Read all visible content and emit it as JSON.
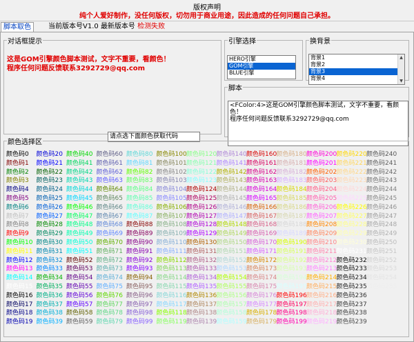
{
  "notice": {
    "title": "版权声明",
    "text": "纯个人爱好制作，没任何版权，切勿用于商业用途，因此造成的任何问题自己承担。"
  },
  "tabs": {
    "active_label": "脚本取色"
  },
  "version_info": {
    "current": "当前版本号V1.0",
    "latest_label": "最新版本号",
    "latest_status": "检测失败"
  },
  "preview": {
    "legend": "对话框提示",
    "line1": "这是GOM引擎颜色脚本测试，文字不重要，看颜色！",
    "line2": "程序任何问题反馈联系3292729@qq.com"
  },
  "code_field": {
    "value": "请点选下面颜色获取代码"
  },
  "engine": {
    "legend": "引擎选择",
    "options": [
      "HERO引擎",
      "GOM引擎",
      "BLUE引擎"
    ],
    "selected_index": 1
  },
  "background": {
    "legend": "换背景",
    "options": [
      "背景1",
      "背景2",
      "背景3",
      "背景4"
    ],
    "selected_index": 2
  },
  "script": {
    "legend": "脚本",
    "line1": "<FColor:4>这是GOM引擎颜色脚本测试，文字不重要，看颜色！",
    "line2": "程序任何问题反馈联系3292729@qq.com"
  },
  "color_section": {
    "legend": "颜色选择区",
    "item_prefix": "颜色码",
    "count": 256,
    "rows_per_column": 20,
    "palette": [
      "#000000",
      "#800000",
      "#008000",
      "#808000",
      "#000080",
      "#800080",
      "#008080",
      "#c0c0c0",
      "#808080",
      "#ff0000",
      "#00ff00",
      "#ffff00",
      "#0000ff",
      "#ff00ff",
      "#00ffff",
      "#ffffff",
      "#000000",
      "#00005f",
      "#000087",
      "#0000af",
      "#0000d7",
      "#0000ff",
      "#005f00",
      "#005f5f",
      "#005f87",
      "#005faf",
      "#005fd7",
      "#005fff",
      "#008700",
      "#00875f",
      "#008787",
      "#0087af",
      "#0087d7",
      "#0087ff",
      "#00af00",
      "#00af5f",
      "#00af87",
      "#00afaf",
      "#00afd7",
      "#00afff",
      "#00d700",
      "#00d75f",
      "#00d787",
      "#00d7af",
      "#00d7d7",
      "#00d7ff",
      "#00ff00",
      "#00ff5f",
      "#00ff87",
      "#00ffaf",
      "#00ffd7",
      "#00ffff",
      "#5f0000",
      "#5f005f",
      "#5f0087",
      "#5f00af",
      "#5f00d7",
      "#5f00ff",
      "#5f5f00",
      "#5f5f5f",
      "#5f5f87",
      "#5f5faf",
      "#5f5fd7",
      "#5f5fff",
      "#5f8700",
      "#5f875f",
      "#5f8787",
      "#5f87af",
      "#5f87d7",
      "#5f87ff",
      "#5faf00",
      "#5faf5f",
      "#5faf87",
      "#5fafaf",
      "#5fafd7",
      "#5fafff",
      "#5fd700",
      "#5fd75f",
      "#5fd787",
      "#5fd7af",
      "#5fd7d7",
      "#5fd7ff",
      "#5fff00",
      "#5fff5f",
      "#5fff87",
      "#5fffaf",
      "#5fffd7",
      "#5fffff",
      "#870000",
      "#87005f",
      "#870087",
      "#8700af",
      "#8700d7",
      "#8700ff",
      "#875f00",
      "#875f5f",
      "#875f87",
      "#875faf",
      "#875fd7",
      "#875fff",
      "#878700",
      "#87875f",
      "#878787",
      "#8787af",
      "#8787d7",
      "#8787ff",
      "#87af00",
      "#87af5f",
      "#87af87",
      "#87afaf",
      "#87afd7",
      "#87afff",
      "#87d700",
      "#87d75f",
      "#87d787",
      "#87d7af",
      "#87d7d7",
      "#87d7ff",
      "#87ff00",
      "#87ff5f",
      "#87ff87",
      "#87ffaf",
      "#87ffd7",
      "#87ffff",
      "#af0000",
      "#af005f",
      "#af0087",
      "#af00af",
      "#af00d7",
      "#af00ff",
      "#af5f00",
      "#af5f5f",
      "#af5f87",
      "#af5faf",
      "#af5fd7",
      "#af5fff",
      "#af8700",
      "#af875f",
      "#af8787",
      "#af87af",
      "#af87d7",
      "#af87ff",
      "#afaf00",
      "#afaf5f",
      "#afaf87",
      "#afafaf",
      "#afafd7",
      "#afafff",
      "#afd700",
      "#afd75f",
      "#afd787",
      "#afd7af",
      "#afd7d7",
      "#afd7ff",
      "#afff00",
      "#afff5f",
      "#afff87",
      "#afffaf",
      "#afffd7",
      "#afffff",
      "#d70000",
      "#d7005f",
      "#d70087",
      "#d700af",
      "#d700d7",
      "#d700ff",
      "#d75f00",
      "#d75f5f",
      "#d75f87",
      "#d75faf",
      "#d75fd7",
      "#d75fff",
      "#d78700",
      "#d7875f",
      "#d78787",
      "#d787af",
      "#d787d7",
      "#d787ff",
      "#d7af00",
      "#d7af5f",
      "#d7af87",
      "#d7afaf",
      "#d7afd7",
      "#d7afff",
      "#d7d700",
      "#d7d75f",
      "#d7d787",
      "#d7d7af",
      "#d7d7d7",
      "#d7d7ff",
      "#d7ff00",
      "#d7ff5f",
      "#d7ff87",
      "#d7ffaf",
      "#d7ffd7",
      "#d7ffff",
      "#ff0000",
      "#ff005f",
      "#ff0087",
      "#ff00af",
      "#ff00d7",
      "#ff00ff",
      "#ff5f00",
      "#ff5f5f",
      "#ff5f87",
      "#ff5faf",
      "#ff5fd7",
      "#ff5fff",
      "#ff8700",
      "#ff875f",
      "#ff8787",
      "#ff87af",
      "#ff87d7",
      "#ff87ff",
      "#ffaf00",
      "#ffaf5f",
      "#ffaf87",
      "#ffafaf",
      "#ffafd7",
      "#ffafff",
      "#ffd700",
      "#ffd75f",
      "#ffd787",
      "#ffd7af",
      "#ffd7d7",
      "#ffd7ff",
      "#ffff00",
      "#ffff5f",
      "#ffff87",
      "#ffffaf",
      "#ffffd7",
      "#ffffff",
      "#080808",
      "#121212",
      "#1c1c1c",
      "#262626",
      "#303030",
      "#3a3a3a",
      "#444444",
      "#4e4e4e",
      "#585858",
      "#626262",
      "#6c6c6c",
      "#767676",
      "#808080",
      "#8a8a8a",
      "#949494",
      "#9e9e9e",
      "#a8a8a8",
      "#b2b2b2",
      "#bcbcbc",
      "#c6c6c6",
      "#d0d0d0",
      "#dadada",
      "#e4e4e4",
      "#eeeeee"
    ]
  }
}
